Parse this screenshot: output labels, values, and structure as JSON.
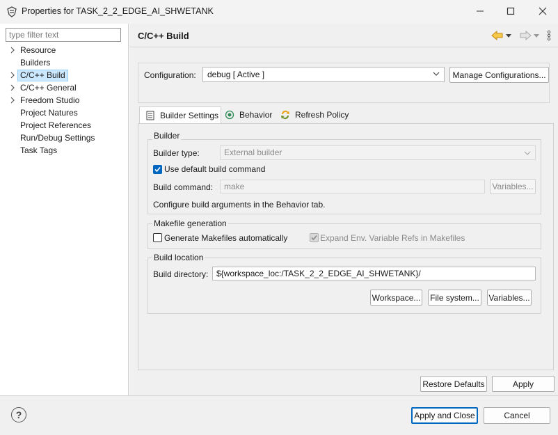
{
  "window": {
    "title": "Properties for TASK_2_2_EDGE_AI_SHWETANK",
    "icons": [
      "app-icon",
      "minimize-icon",
      "maximize-icon",
      "close-icon"
    ]
  },
  "sidebar": {
    "filter_placeholder": "type filter text",
    "items": [
      {
        "label": "Resource",
        "expandable": true
      },
      {
        "label": "Builders",
        "expandable": false
      },
      {
        "label": "C/C++ Build",
        "expandable": true,
        "selected": true
      },
      {
        "label": "C/C++ General",
        "expandable": true
      },
      {
        "label": "Freedom Studio",
        "expandable": true
      },
      {
        "label": "Project Natures",
        "expandable": false
      },
      {
        "label": "Project References",
        "expandable": false
      },
      {
        "label": "Run/Debug Settings",
        "expandable": false
      },
      {
        "label": "Task Tags",
        "expandable": false
      }
    ]
  },
  "page": {
    "title": "C/C++ Build",
    "nav_icons": [
      "back-arrow-icon",
      "dropdown-icon",
      "forward-arrow-icon",
      "dropdown-icon",
      "more-options-icon"
    ]
  },
  "configuration": {
    "label": "Configuration:",
    "value": "debug  [ Active ]",
    "manage_button": "Manage Configurations..."
  },
  "tabs": [
    {
      "label": "Builder Settings",
      "icon": "builder-settings-icon",
      "active": true
    },
    {
      "label": "Behavior",
      "icon": "behavior-icon",
      "active": false
    },
    {
      "label": "Refresh Policy",
      "icon": "refresh-policy-icon",
      "active": false
    }
  ],
  "builder": {
    "group_title": "Builder",
    "type_label": "Builder type:",
    "type_value": "External builder",
    "use_default_label": "Use default build command",
    "use_default_checked": true,
    "command_label": "Build command:",
    "command_value": "make",
    "variables_button": "Variables...",
    "hint": "Configure build arguments in the Behavior tab."
  },
  "makefile": {
    "group_title": "Makefile generation",
    "generate_label": "Generate Makefiles automatically",
    "generate_checked": false,
    "expand_label": "Expand Env. Variable Refs in Makefiles",
    "expand_checked": true
  },
  "location": {
    "group_title": "Build location",
    "dir_label": "Build directory:",
    "dir_value": "${workspace_loc:/TASK_2_2_EDGE_AI_SHWETANK}/",
    "workspace_button": "Workspace...",
    "filesystem_button": "File system...",
    "variables_button": "Variables..."
  },
  "buttons": {
    "restore_defaults": "Restore Defaults",
    "apply": "Apply",
    "apply_and_close": "Apply and Close",
    "cancel": "Cancel",
    "help": "?"
  },
  "colors": {
    "accent": "#0067c0",
    "selection_bg": "#cce8ff",
    "nav_arrow": "#e8a317"
  }
}
